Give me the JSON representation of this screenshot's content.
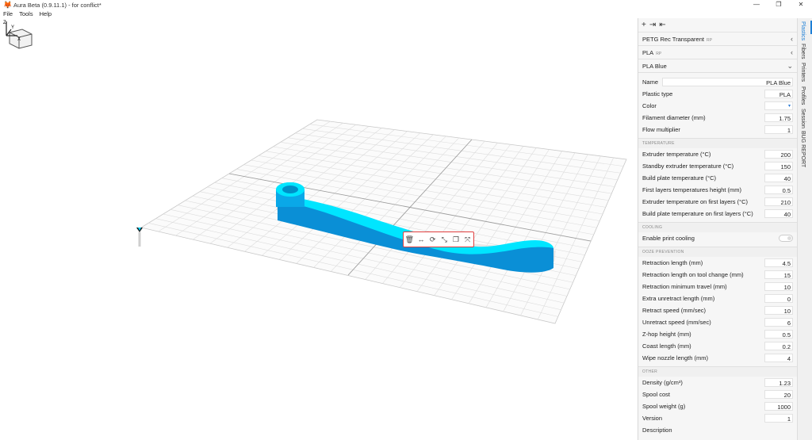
{
  "app": {
    "title": "Aura Beta (0.9.11.1) - for conflict*",
    "icon": "fox-logo-icon",
    "window_controls": [
      "—",
      "❐",
      "✕"
    ]
  },
  "menu": [
    "File",
    "Tools",
    "Help"
  ],
  "viewport": {
    "view_cube": "view-cube-icon",
    "axes": {
      "z": "Z",
      "y": "Y",
      "x": "X"
    },
    "model_color": "#00d4ff",
    "toolbar_icons": [
      "delete-icon",
      "move-icon",
      "rotate-icon",
      "scale-icon",
      "duplicate-icon",
      "arrange-icon"
    ],
    "toolbar_glyphs": [
      "🗑",
      "↔",
      "⟳",
      "⤡",
      "❐",
      "⤧"
    ]
  },
  "panel": {
    "top_icons": [
      "+",
      "⇥",
      "⇤"
    ],
    "selectors": [
      {
        "label": "PETG Rec Transparent",
        "tag": "RP",
        "chevron": "‹"
      },
      {
        "label": "PLA",
        "tag": "RP",
        "chevron": "‹"
      },
      {
        "label": "PLA Blue",
        "tag": "",
        "chevron": "⌄"
      }
    ],
    "general": [
      {
        "label": "Name",
        "value": "PLA Blue"
      },
      {
        "label": "Plastic type",
        "value": "PLA"
      },
      {
        "label": "Color",
        "value": ""
      },
      {
        "label": "Filament diameter (mm)",
        "value": "1.75"
      },
      {
        "label": "Flow multiplier",
        "value": "1"
      }
    ],
    "temperature_head": "TEMPERATURE",
    "temperature": [
      {
        "label": "Extruder temperature (°C)",
        "value": "200"
      },
      {
        "label": "Standby extruder temperature (°C)",
        "value": "150"
      },
      {
        "label": "Build plate temperature (°C)",
        "value": "40"
      },
      {
        "label": "First layers temperatures height (mm)",
        "value": "0.5"
      },
      {
        "label": "Extruder temperature on first layers (°C)",
        "value": "210"
      },
      {
        "label": "Build plate temperature on first layers (°C)",
        "value": "40"
      }
    ],
    "cooling_head": "COOLING",
    "cooling": [
      {
        "label": "Enable print cooling",
        "value": "off"
      }
    ],
    "ooze_head": "OOZE PREVENTION",
    "ooze": [
      {
        "label": "Retraction length (mm)",
        "value": "4.5"
      },
      {
        "label": "Retraction length on tool change (mm)",
        "value": "15"
      },
      {
        "label": "Retraction minimum travel (mm)",
        "value": "10"
      },
      {
        "label": "Extra unretract length (mm)",
        "value": "0"
      },
      {
        "label": "Retract speed (mm/sec)",
        "value": "10"
      },
      {
        "label": "Unretract speed (mm/sec)",
        "value": "6"
      },
      {
        "label": "Z-hop height (mm)",
        "value": "0.5"
      },
      {
        "label": "Coast length (mm)",
        "value": "0.2"
      },
      {
        "label": "Wipe nozzle length (mm)",
        "value": "4"
      }
    ],
    "other_head": "OTHER",
    "other": [
      {
        "label": "Density (g/cm³)",
        "value": "1.23"
      },
      {
        "label": "Spool cost",
        "value": "20"
      },
      {
        "label": "Spool weight (g)",
        "value": "1000"
      },
      {
        "label": "Version",
        "value": "1"
      },
      {
        "label": "Description",
        "value": ""
      }
    ]
  },
  "vtabs": [
    "Plastics",
    "Fibers",
    "Printers",
    "Profiles",
    "Session",
    "BUG REPORT"
  ]
}
